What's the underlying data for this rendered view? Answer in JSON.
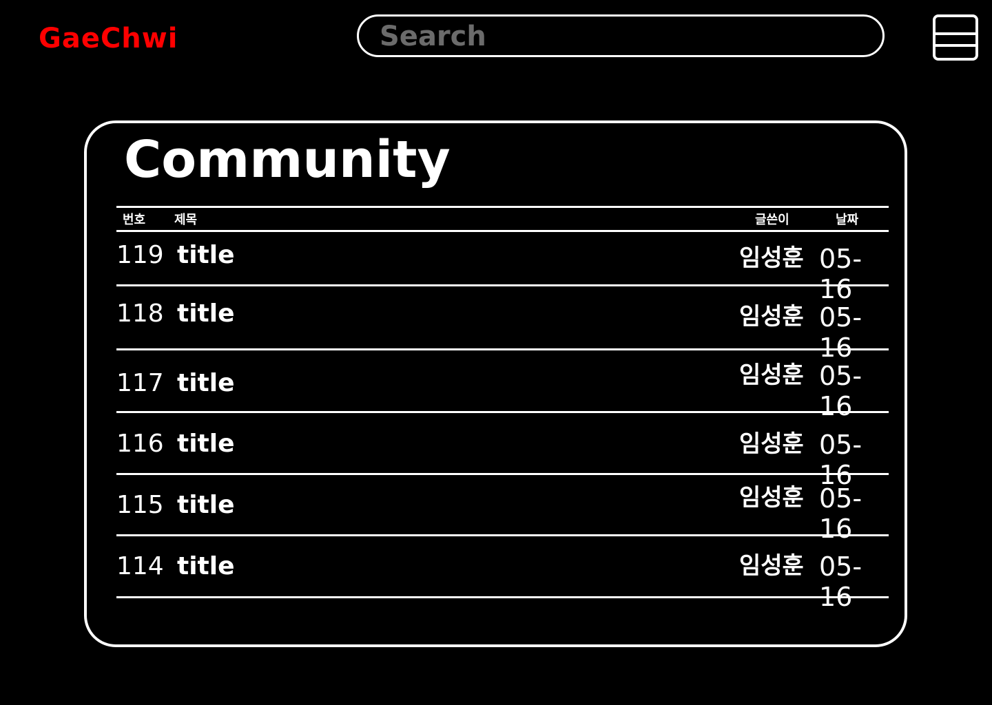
{
  "header": {
    "logo": "GaeChwi",
    "search_placeholder": "Search"
  },
  "board": {
    "title": "Community",
    "columns": {
      "number": "번호",
      "subject": "제목",
      "author": "글쓴이",
      "date": "날짜"
    },
    "posts": [
      {
        "number": "119",
        "title": "title",
        "author": "임성훈",
        "date": "05-16"
      },
      {
        "number": "118",
        "title": "title",
        "author": "임성훈",
        "date": "05-16"
      },
      {
        "number": "117",
        "title": "title",
        "author": "임성훈",
        "date": "05-16"
      },
      {
        "number": "116",
        "title": "title",
        "author": "임성훈",
        "date": "05-16"
      },
      {
        "number": "115",
        "title": "title",
        "author": "임성훈",
        "date": "05-16"
      },
      {
        "number": "114",
        "title": "title",
        "author": "임성훈",
        "date": "05-16"
      }
    ]
  },
  "colors": {
    "background": "#000000",
    "logo": "#ff0000",
    "text": "#ffffff",
    "placeholder": "#6b6b6b"
  }
}
